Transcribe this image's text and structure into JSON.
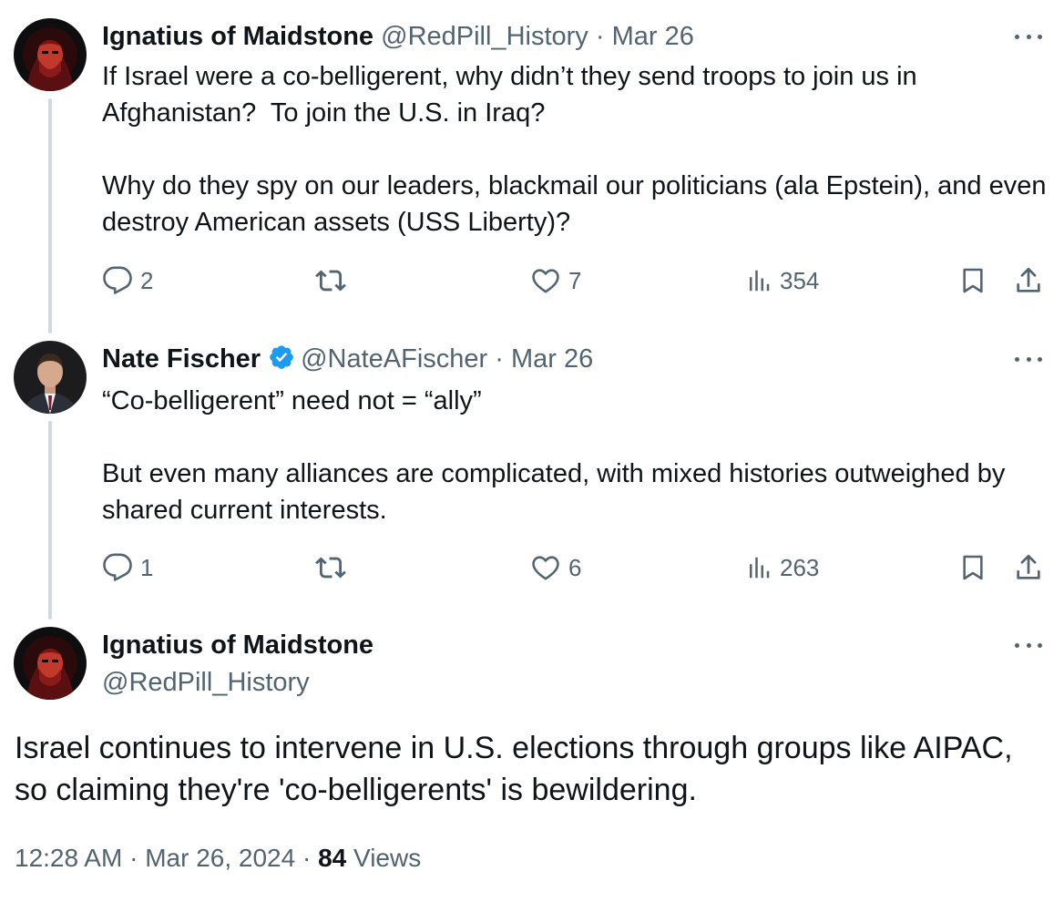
{
  "tweets": [
    {
      "author_name": "Ignatius of Maidstone",
      "handle": "@RedPill_History",
      "separator": "·",
      "date": "Mar 26",
      "avatar": "red-hooded-figure-avatar",
      "text": "If Israel were a co-belligerent, why didn’t they send troops to join us in Afghanistan?  To join the U.S. in Iraq?\n\nWhy do they spy on our leaders, blackmail our politicians (ala Epstein), and even destroy American assets (USS Liberty)?",
      "replies": "2",
      "retweets": "",
      "likes": "7",
      "views": "354"
    },
    {
      "author_name": "Nate Fischer",
      "verified": true,
      "handle": "@NateAFischer",
      "separator": "·",
      "date": "Mar 26",
      "avatar": "man-in-suit-avatar",
      "text": "“Co-belligerent” need not = “ally”\n\nBut even many alliances are complicated, with mixed histories outweighed by shared current interests.",
      "replies": "1",
      "retweets": "",
      "likes": "6",
      "views": "263"
    }
  ],
  "main_tweet": {
    "author_name": "Ignatius of Maidstone",
    "handle": "@RedPill_History",
    "avatar": "red-hooded-figure-avatar",
    "text": "Israel continues to intervene in U.S. elections through groups like AIPAC, so claiming they're 'co-belligerents' is bewildering.",
    "time": "12:28 AM",
    "separator": "·",
    "date": "Mar 26, 2024",
    "views_count": "84",
    "views_label": "Views"
  },
  "colors": {
    "text": "#0f1419",
    "secondary": "#536471",
    "verified": "#1d9bf0",
    "thread_line": "#cfd9de"
  }
}
